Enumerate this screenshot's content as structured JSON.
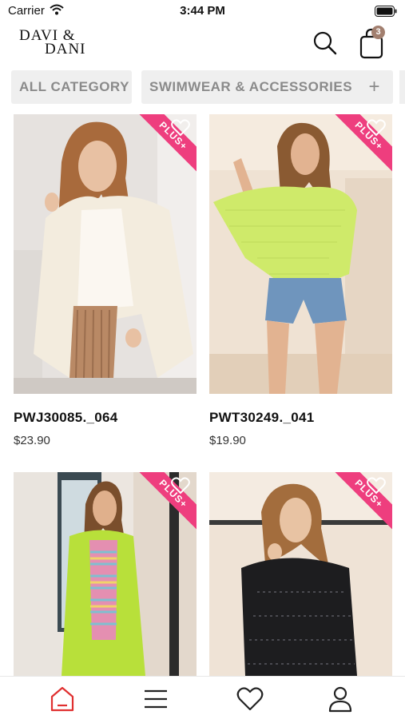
{
  "status_bar": {
    "carrier": "Carrier",
    "time": "3:44 PM"
  },
  "header": {
    "logo_line1": "DAVI &",
    "logo_line2": "DANI",
    "cart_count": "3",
    "accent_color": "#a27f6f"
  },
  "categories": [
    {
      "label": "ALL CATEGORY"
    },
    {
      "label": "SWIMWEAR & ACCESSORIES",
      "action": "+"
    }
  ],
  "products": [
    {
      "name": "PWJ30085._064",
      "price": "$23.90",
      "badge": "PLUS+",
      "image": "woman in cream cardigan"
    },
    {
      "name": "PWT30249._041",
      "price": "$19.90",
      "badge": "PLUS+",
      "image": "woman in lime mesh top and denim shorts"
    },
    {
      "name": "",
      "price": "",
      "badge": "PLUS+",
      "image": "woman in lime fringe kimono"
    },
    {
      "name": "",
      "price": "",
      "badge": "PLUS+",
      "image": "woman in black sequin jacket"
    }
  ],
  "bottom_nav": [
    {
      "icon": "home-icon",
      "active": true
    },
    {
      "icon": "menu-icon",
      "active": false
    },
    {
      "icon": "heart-icon",
      "active": false
    },
    {
      "icon": "profile-icon",
      "active": false
    }
  ],
  "colors": {
    "badge_pink": "#ee3e7e",
    "active_nav": "#e03030"
  }
}
